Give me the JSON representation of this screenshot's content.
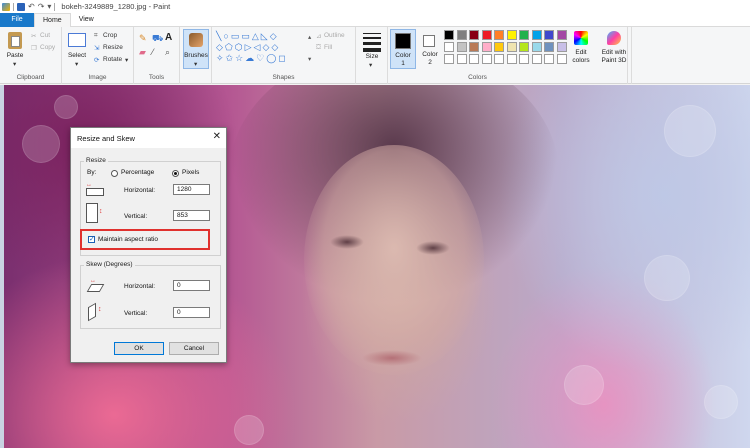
{
  "window": {
    "title": "bokeh-3249889_1280.jpg - Paint"
  },
  "tabs": [
    {
      "label": "File"
    },
    {
      "label": "Home"
    },
    {
      "label": "View"
    }
  ],
  "ribbon": {
    "clipboard": {
      "label": "Clipboard",
      "paste": "Paste",
      "cut": "Cut",
      "copy": "Copy"
    },
    "image": {
      "label": "Image",
      "select": "Select",
      "crop": "Crop",
      "resize": "Resize",
      "rotate": "Rotate"
    },
    "tools": {
      "label": "Tools"
    },
    "brushes": {
      "label": "Brushes"
    },
    "shapes": {
      "label": "Shapes",
      "outline": "Outline",
      "fill": "Fill"
    },
    "size": {
      "label": "Size"
    },
    "colors": {
      "label": "Colors",
      "color1": "Color\n1",
      "color1_a": "Color",
      "color1_b": "1",
      "color2_a": "Color",
      "color2_b": "2",
      "edit_a": "Edit",
      "edit_b": "colors",
      "paint3d_a": "Edit with",
      "paint3d_b": "Paint 3D",
      "row1": [
        "#000000",
        "#7f7f7f",
        "#880015",
        "#ed1c24",
        "#ff7f27",
        "#fff200",
        "#22b14c",
        "#00a2e8",
        "#3f48cc",
        "#a349a4"
      ],
      "row2": [
        "#ffffff",
        "#c3c3c3",
        "#b97a57",
        "#ffaec9",
        "#ffc90e",
        "#efe4b0",
        "#b5e61d",
        "#99d9ea",
        "#7092be",
        "#c8bfe7"
      ],
      "row3": [
        "#ffffff",
        "#ffffff",
        "#ffffff",
        "#ffffff",
        "#ffffff",
        "#ffffff",
        "#ffffff",
        "#ffffff",
        "#ffffff",
        "#ffffff"
      ]
    }
  },
  "dialog": {
    "title": "Resize and Skew",
    "resize": {
      "section_label": "Resize",
      "by_label": "By:",
      "percentage_label": "Percentage",
      "pixels_label": "Pixels",
      "selected_unit": "Pixels",
      "horizontal_label": "Horizontal:",
      "horizontal_value": "1280",
      "vertical_label": "Vertical:",
      "vertical_value": "853",
      "maintain_aspect_label": "Maintain aspect ratio",
      "maintain_aspect_checked": true
    },
    "skew": {
      "section_label": "Skew (Degrees)",
      "horizontal_label": "Horizontal:",
      "horizontal_value": "0",
      "vertical_label": "Vertical:",
      "vertical_value": "0"
    },
    "ok_label": "OK",
    "cancel_label": "Cancel"
  },
  "annotation": {
    "highlight_color": "#e0312e"
  }
}
